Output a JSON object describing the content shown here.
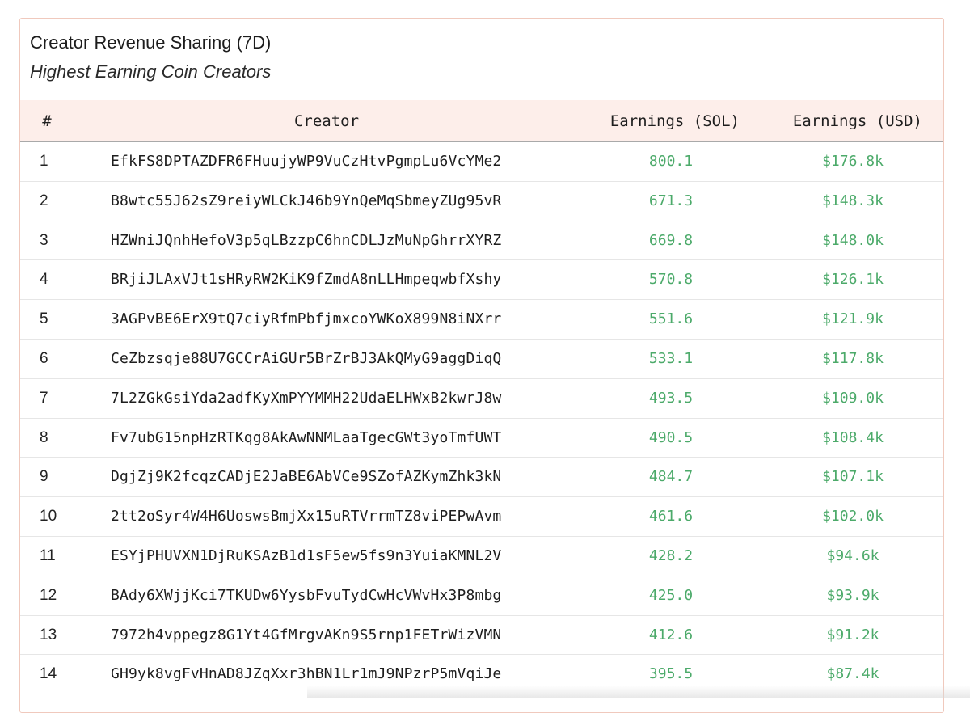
{
  "card": {
    "title": "Creator Revenue Sharing (7D)",
    "subtitle": "Highest Earning Coin Creators"
  },
  "table": {
    "columns": {
      "rank": "#",
      "creator": "Creator",
      "earnings_sol": "Earnings (SOL)",
      "earnings_usd": "Earnings (USD)"
    },
    "rows": [
      {
        "rank": "1",
        "creator": "EfkFS8DPTAZDFR6FHuujyWP9VuCzHtvPgmpLu6VcYMe2",
        "sol": "800.1",
        "usd": "$176.8k"
      },
      {
        "rank": "2",
        "creator": "B8wtc55J62sZ9reiyWLCkJ46b9YnQeMqSbmeyZUg95vR",
        "sol": "671.3",
        "usd": "$148.3k"
      },
      {
        "rank": "3",
        "creator": "HZWniJQnhHefoV3p5qLBzzpC6hnCDLJzMuNpGhrrXYRZ",
        "sol": "669.8",
        "usd": "$148.0k"
      },
      {
        "rank": "4",
        "creator": "BRjiJLAxVJt1sHRyRW2KiK9fZmdA8nLLHmpeqwbfXshy",
        "sol": "570.8",
        "usd": "$126.1k"
      },
      {
        "rank": "5",
        "creator": "3AGPvBE6ErX9tQ7ciyRfmPbfjmxcoYWKoX899N8iNXrr",
        "sol": "551.6",
        "usd": "$121.9k"
      },
      {
        "rank": "6",
        "creator": "CeZbzsqje88U7GCCrAiGUr5BrZrBJ3AkQMyG9aggDiqQ",
        "sol": "533.1",
        "usd": "$117.8k"
      },
      {
        "rank": "7",
        "creator": "7L2ZGkGsiYda2adfKyXmPYYMMH22UdaELHWxB2kwrJ8w",
        "sol": "493.5",
        "usd": "$109.0k"
      },
      {
        "rank": "8",
        "creator": "Fv7ubG15npHzRTKqg8AkAwNNMLaaTgecGWt3yoTmfUWT",
        "sol": "490.5",
        "usd": "$108.4k"
      },
      {
        "rank": "9",
        "creator": "DgjZj9K2fcqzCADjE2JaBE6AbVCe9SZofAZKymZhk3kN",
        "sol": "484.7",
        "usd": "$107.1k"
      },
      {
        "rank": "10",
        "creator": "2tt2oSyr4W4H6UoswsBmjXx15uRTVrrmTZ8viPEPwAvm",
        "sol": "461.6",
        "usd": "$102.0k"
      },
      {
        "rank": "11",
        "creator": "ESYjPHUVXN1DjRuKSAzB1d1sF5ew5fs9n3YuiaKMNL2V",
        "sol": "428.2",
        "usd": "$94.6k"
      },
      {
        "rank": "12",
        "creator": "BAdy6XWjjKci7TKUDw6YysbFvuTydCwHcVWvHx3P8mbg",
        "sol": "425.0",
        "usd": "$93.9k"
      },
      {
        "rank": "13",
        "creator": "7972h4vppegz8G1Yt4GfMrgvAKn9S5rnp1FETrWizVMN",
        "sol": "412.6",
        "usd": "$91.2k"
      },
      {
        "rank": "14",
        "creator": "GH9yk8vgFvHnAD8JZqXxr3hBN1Lr1mJ9NPzrP5mVqiJe",
        "sol": "395.5",
        "usd": "$87.4k"
      }
    ]
  },
  "colors": {
    "accent_green": "#4caa6a",
    "header_bg": "#fdeeea",
    "card_border": "#f0c9bd"
  }
}
